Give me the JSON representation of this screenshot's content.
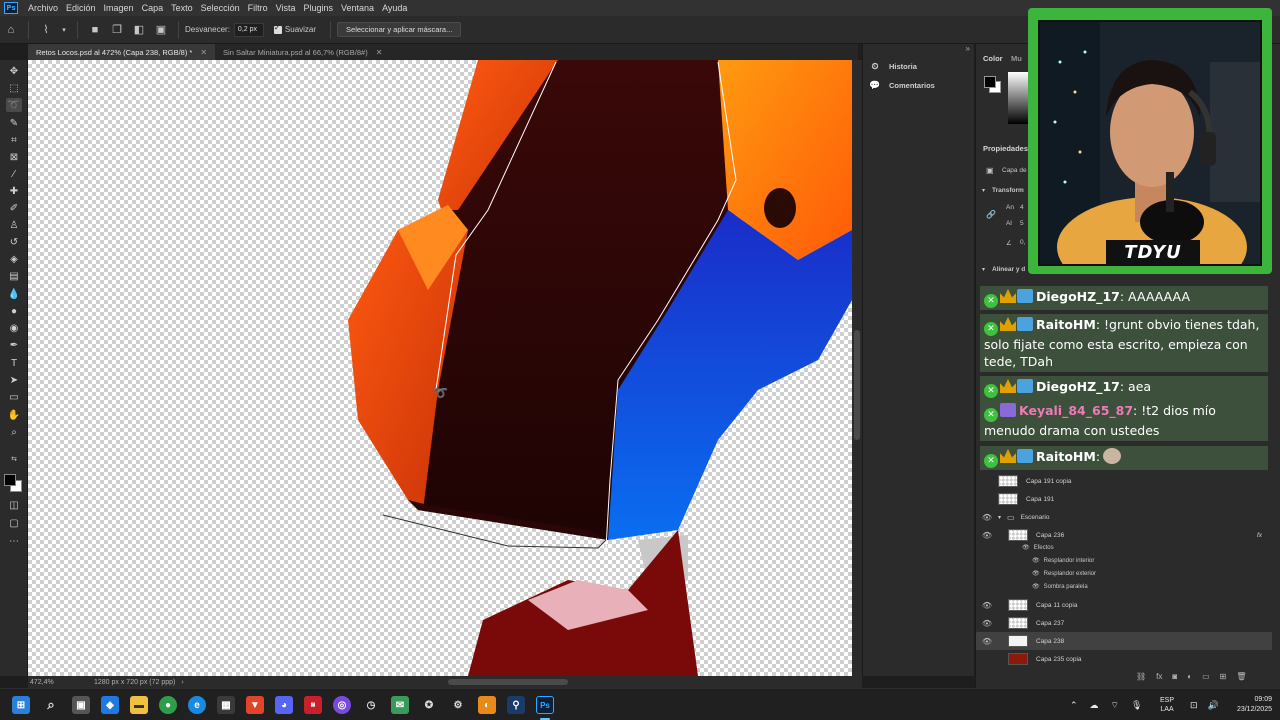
{
  "menu": {
    "items": [
      "Archivo",
      "Edición",
      "Imagen",
      "Capa",
      "Texto",
      "Selección",
      "Filtro",
      "Vista",
      "Plugins",
      "Ventana",
      "Ayuda"
    ]
  },
  "options_bar": {
    "feather_label": "Desvanecer:",
    "feather_value": "0,2 px",
    "smooth_label": "Suavizar",
    "mask_button": "Seleccionar y aplicar máscara..."
  },
  "tabs": [
    {
      "label": "Retos Locos.psd al 472% (Capa 238, RGB/8) *",
      "active": true
    },
    {
      "label": "Sin Saltar Miniatura.psd al 66,7% (RGB/8#)",
      "active": false
    }
  ],
  "status": {
    "zoom": "472,4%",
    "doc_info": "1280 px x 720 px (72 ppp)"
  },
  "mid_panel": {
    "history": "Historia",
    "comments": "Comentarios"
  },
  "right_panel": {
    "color_tab": "Color",
    "color_tab2": "Mu",
    "properties": "Propiedades",
    "layer_type": "Capa de",
    "transform": "Transform",
    "w_label": "An",
    "w_value": "4",
    "x_label": "X",
    "x_value": "4",
    "h_label": "Al",
    "h_value": "5",
    "y_label": "Y",
    "y_value": "5",
    "angle_value": "0,",
    "align": "Alinear y d"
  },
  "layers": [
    {
      "name": "Capa 191 copia",
      "visible": false,
      "selected": false
    },
    {
      "name": "Capa 191",
      "visible": false,
      "selected": false
    },
    {
      "name": "Escenario",
      "visible": true,
      "group": true,
      "selected": false
    },
    {
      "name": "Capa 236",
      "visible": true,
      "fx": "fx",
      "selected": false
    },
    {
      "name": "Capa 11 copia",
      "visible": true,
      "selected": false
    },
    {
      "name": "Capa 237",
      "visible": true,
      "selected": false
    },
    {
      "name": "Capa 238",
      "visible": true,
      "selected": true
    },
    {
      "name": "Capa 235 copia",
      "visible": false,
      "selected": false
    }
  ],
  "effects": {
    "label": "Efectos",
    "items": [
      "Resplandor interior",
      "Resplandor exterior",
      "Sombra paralela"
    ]
  },
  "webcam": {
    "name": "TDYU"
  },
  "chat": [
    {
      "user": "DiegoHZ_17",
      "text": ": AAAAAAA",
      "color": "#ffffff",
      "badges": [
        "x",
        "crown",
        "gg"
      ]
    },
    {
      "user": "RaitoHM",
      "text": ": !grunt obvio tienes tdah, solo fijate como esta escrito, empieza con tede, TDah",
      "color": "#ffffff",
      "badges": [
        "x",
        "crown",
        "gg"
      ]
    },
    {
      "user": "DiegoHZ_17",
      "text": ": aea",
      "color": "#ffffff",
      "badges": [
        "x",
        "crown",
        "gg"
      ]
    },
    {
      "user": "Keyali_84_65_87",
      "text": ": !t2 dios mío menudo drama con ustedes",
      "color": "#f07ab8",
      "badges": [
        "x",
        "gift"
      ]
    },
    {
      "user": "RaitoHM",
      "text": ":",
      "color": "#ffffff",
      "badges": [
        "x",
        "crown",
        "gg"
      ],
      "emote": true
    }
  ],
  "tray": {
    "lang": "ESP",
    "region": "LAA",
    "time": "09:09",
    "date": "23/12/2025"
  },
  "colors": {
    "ps_blue": "#31a8ff",
    "webcam_frame": "#3db53d",
    "chat_bg": "#3e543e",
    "taskbar_accent": "#60cdff"
  }
}
